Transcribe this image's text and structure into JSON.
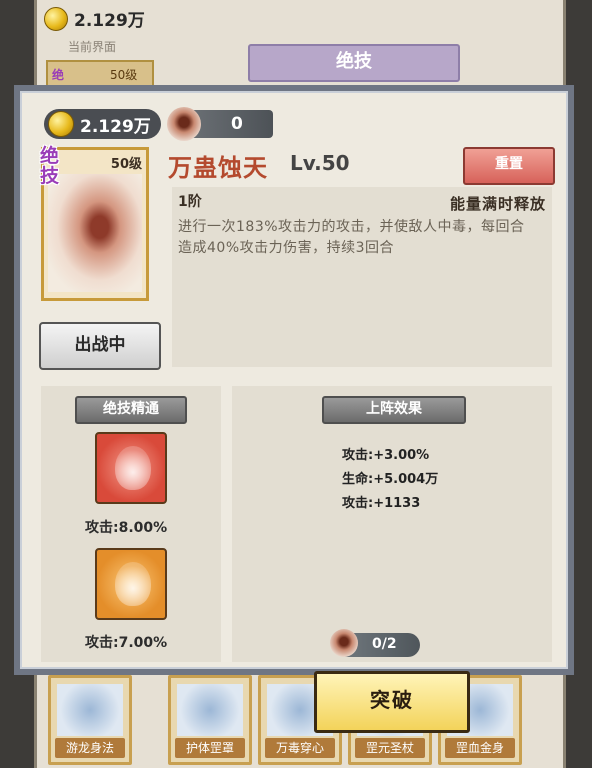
{
  "background": {
    "gold": "2.129万",
    "subtitle": "当前界面",
    "ribbon": "绝技",
    "card_tag": "绝",
    "card_level": "50级",
    "bottom_cards": [
      "游龙身法",
      "护体罡罩",
      "万毒穿心",
      "罡元圣杖",
      "罡血金身"
    ]
  },
  "modal": {
    "gold": "2.129万",
    "token_count": "0",
    "skill": {
      "tag": "绝技",
      "level_badge": "50级",
      "name": "万蛊蚀天",
      "level": "Lv.50",
      "reset_label": "重置",
      "deploy_label": "出战中",
      "tier": "1阶",
      "release": "能量满时释放",
      "description": "进行一次183%攻击力的攻击，并使敌人中毒，每回合造成40%攻击力伤害，持续3回合"
    },
    "mastery": {
      "title": "绝技精通",
      "items": [
        {
          "value": "攻击:8.00%",
          "color": "red"
        },
        {
          "value": "攻击:7.00%",
          "color": "orange"
        }
      ]
    },
    "deploy_effect": {
      "title": "上阵效果",
      "stats": [
        "攻击:+3.00%",
        "生命:+5.004万",
        "攻击:+1133"
      ],
      "cost": "0/2",
      "button": "突破"
    }
  },
  "colors": {
    "skill_name": "#b44a2e",
    "reset": "#d7625a",
    "breakthrough": "#f3d35a"
  }
}
